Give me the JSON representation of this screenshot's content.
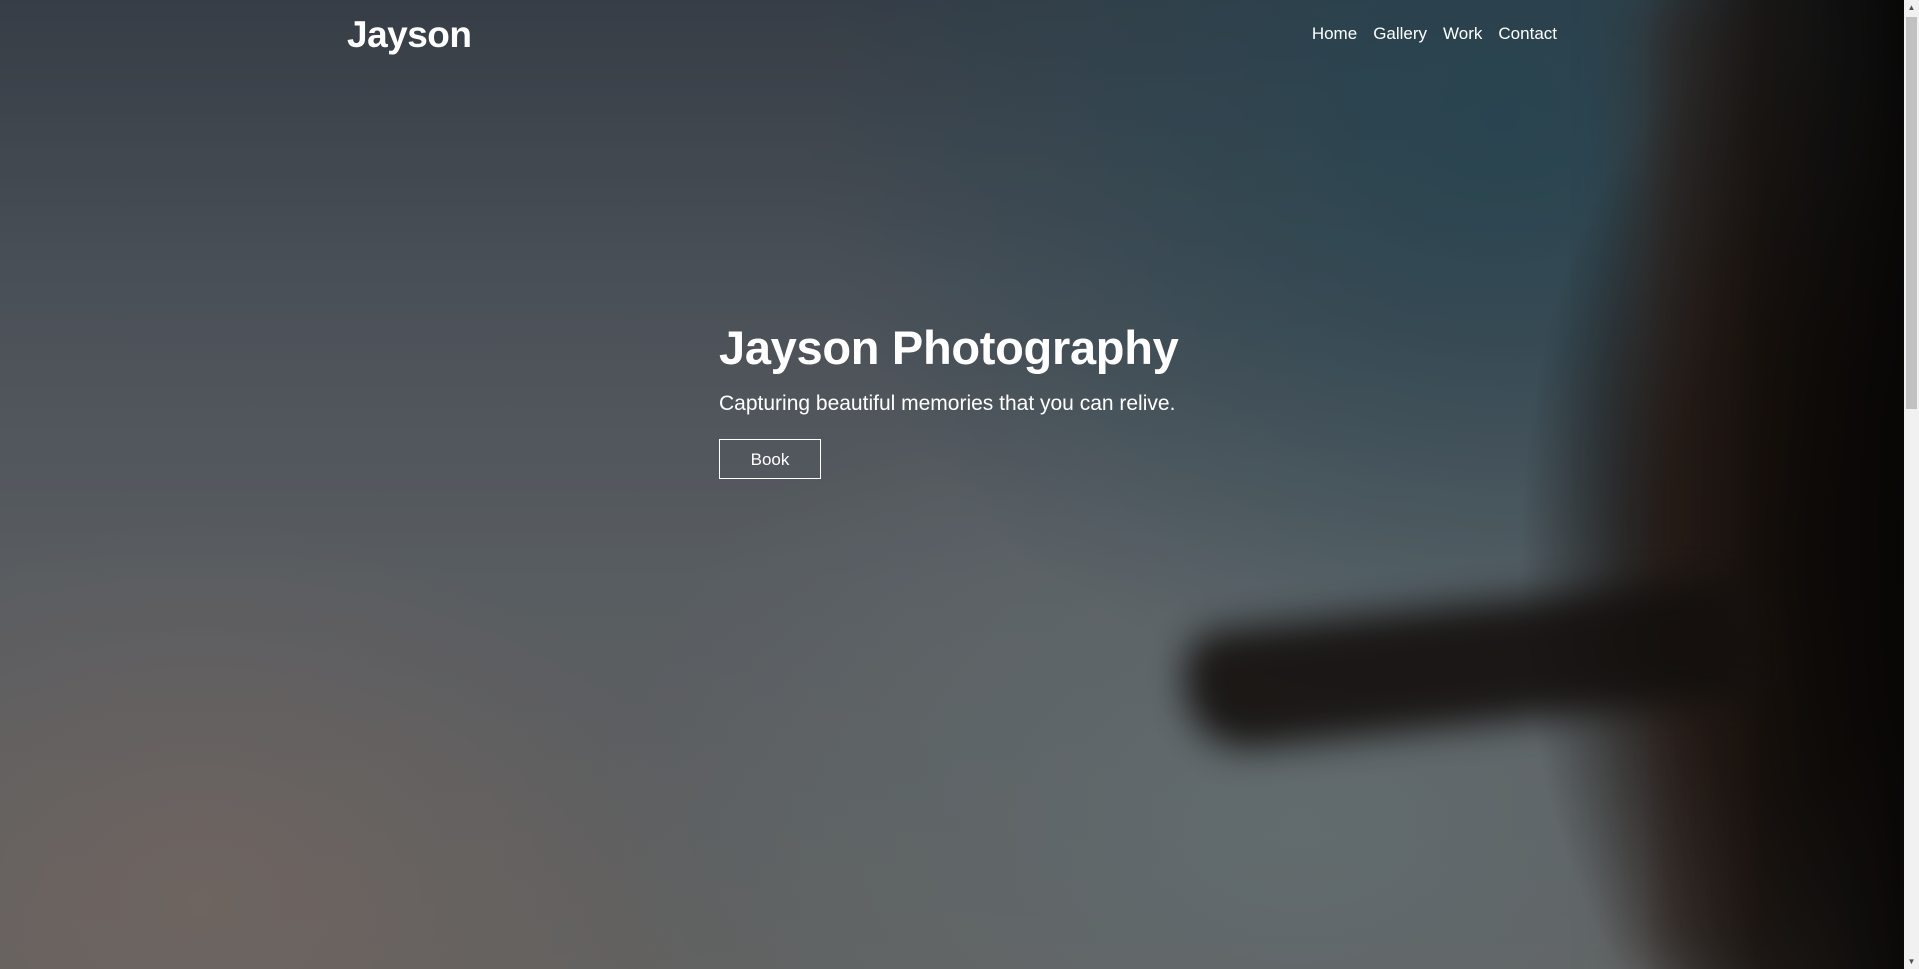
{
  "brand": "Jayson",
  "nav": {
    "items": [
      {
        "label": "Home"
      },
      {
        "label": "Gallery"
      },
      {
        "label": "Work"
      },
      {
        "label": "Contact"
      }
    ]
  },
  "hero": {
    "title": "Jayson Photography",
    "subtitle": "Capturing beautiful memories that you can relive.",
    "button_label": "Book"
  },
  "scrollbar": {
    "up_icon": "chevron-up-icon",
    "down_icon": "chevron-down-icon"
  },
  "colors": {
    "text": "#ffffff",
    "scroll_track": "#f1f1f1",
    "scroll_thumb": "#c1c1c1"
  }
}
